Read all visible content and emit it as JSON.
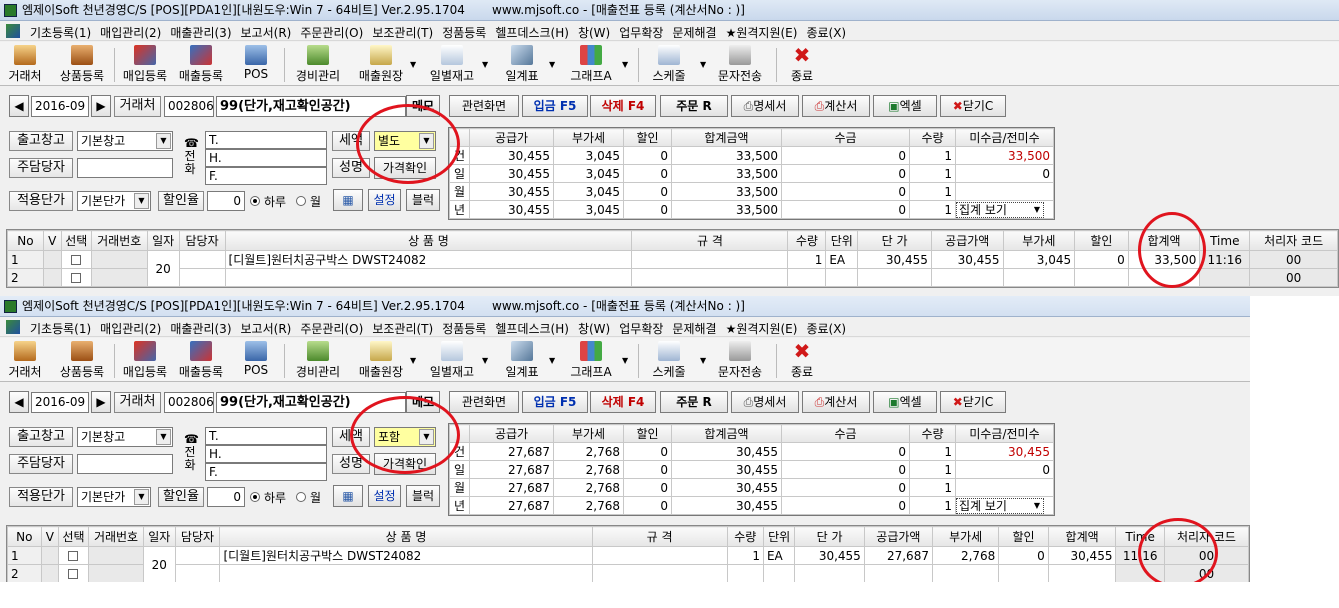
{
  "window": {
    "title": "엠제이Soft 천년경영C/S [POS][PDA1인][내원도우:Win 7 - 64비트] Ver.2.95.1704",
    "url_title": "www.mjsoft.co - [매출전표 등록 (계산서No : )]"
  },
  "menu": [
    "기초등록(1)",
    "매입관리(2)",
    "매출관리(3)",
    "보고서(R)",
    "주문관리(O)",
    "보조관리(T)",
    "정품등록",
    "헬프데스크(H)",
    "창(W)",
    "업무확장",
    "문제해결",
    "★원격지원(E)",
    "종료(X)"
  ],
  "toolbar": {
    "customer": "거래처",
    "product": "상품등록",
    "purchase": "매입등록",
    "sales": "매출등록",
    "pos": "POS",
    "expense": "경비관리",
    "ledger": "매출원장",
    "daily_stock": "일별재고",
    "daily_table": "일계표",
    "graph": "그래프A",
    "schedule": "스케줄",
    "sms": "문자전송",
    "exit": "종료"
  },
  "icons": {
    "customer": "person-card-icon",
    "product": "box-icon",
    "purchase": "purchase-icon",
    "sales": "sales-icon",
    "pos": "pos-icon",
    "expense": "money-stack-icon",
    "ledger": "ledger-icon",
    "daily_stock": "calendar-icon",
    "daily_table": "pen-chart-icon",
    "graph": "bar-graph-icon",
    "schedule": "schedule-icon",
    "sms": "phone-message-icon",
    "exit": "close-x-icon",
    "phone": "phone-icon",
    "calc": "calculator-icon"
  },
  "header": {
    "prev": "◀",
    "next": "▶",
    "month": "2016-09",
    "customer_label": "거래처",
    "customer_code": "002806",
    "customer_name": "99(단가,재고확인공간)",
    "memo": "메모",
    "related": "관련화면",
    "print_inv": "입금 F5",
    "delete": "삭제 F4",
    "order": "주문 R",
    "statement": "명세서",
    "tax_invoice": "계산서",
    "excel": "엑셀",
    "close": "닫기C"
  },
  "form": {
    "warehouse_label": "출고창고",
    "warehouse_value": "기본창고",
    "manager_label": "주담당자",
    "price_label": "적용단가",
    "price_value": "기본단가",
    "discount_label": "할인율",
    "discount_value": "0",
    "daily": "하루",
    "monthly": "월",
    "setting": "설정",
    "block": "블럭",
    "phone_char1": "전",
    "phone_char2": "화",
    "tel": "T.",
    "hp": "H.",
    "fax": "F.",
    "tax_label": "세액",
    "name_label": "성명",
    "price_check": "가격확인"
  },
  "summary": {
    "headers": [
      "공급가",
      "부가세",
      "할인",
      "합계금액",
      "수금",
      "수량",
      "미수금/전미수"
    ],
    "row_labels": [
      "건",
      "일",
      "월",
      "년"
    ],
    "view_select": "집계 보기"
  },
  "grid": {
    "headers": [
      "No",
      "V",
      "선택",
      "거래번호",
      "일자",
      "담당자",
      "상 품 명",
      "규 격",
      "수량",
      "단위",
      "단 가",
      "공급가액",
      "부가세",
      "할인",
      "합계액",
      "Time",
      "처리자 코드"
    ],
    "day": "20",
    "product": "[디월트]원터치공구박스 DWST24082",
    "qty": "1",
    "unit": "EA",
    "unit_price": "30,455",
    "discount": "0",
    "handler": "00"
  },
  "panel1": {
    "tax_mode": "별도",
    "price_check": "가격확인",
    "summary_rows": [
      [
        "30,455",
        "3,045",
        "0",
        "33,500",
        "0",
        "1",
        "33,500"
      ],
      [
        "30,455",
        "3,045",
        "0",
        "33,500",
        "0",
        "1",
        "0"
      ],
      [
        "30,455",
        "3,045",
        "0",
        "33,500",
        "0",
        "1",
        ""
      ],
      [
        "30,455",
        "3,045",
        "0",
        "33,500",
        "0",
        "1",
        ""
      ]
    ],
    "rows": [
      {
        "no": "1",
        "supply": "30,455",
        "vat": "3,045",
        "total": "33,500",
        "time": "11:16"
      },
      {
        "no": "2"
      }
    ]
  },
  "panel2": {
    "tax_mode": "포함",
    "summary_rows": [
      [
        "27,687",
        "2,768",
        "0",
        "30,455",
        "0",
        "1",
        "30,455"
      ],
      [
        "27,687",
        "2,768",
        "0",
        "30,455",
        "0",
        "1",
        "0"
      ],
      [
        "27,687",
        "2,768",
        "0",
        "30,455",
        "0",
        "1",
        ""
      ],
      [
        "27,687",
        "2,768",
        "0",
        "30,455",
        "0",
        "1",
        ""
      ]
    ],
    "rows": [
      {
        "no": "1",
        "supply": "27,687",
        "vat": "2,768",
        "total": "30,455",
        "time": "11:16"
      },
      {
        "no": "2"
      }
    ]
  },
  "colors": {
    "annotation_red": "#e0141e",
    "red_text": "#c00000",
    "tax_yellow": "#ffffa0"
  }
}
